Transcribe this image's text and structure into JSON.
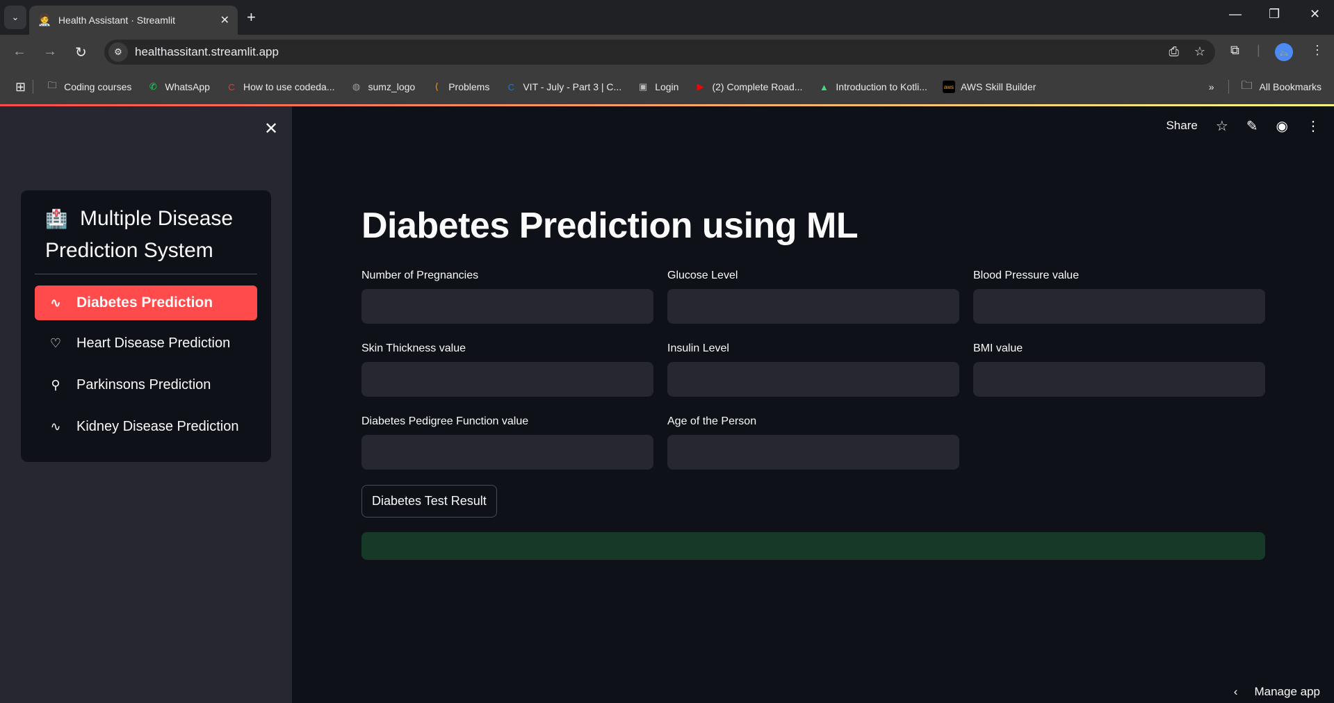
{
  "browser": {
    "tab_title": "Health Assistant · Streamlit",
    "tab_favicon": "🧑‍⚕️",
    "url": "healthassitant.streamlit.app",
    "bookmarks": [
      {
        "label": "Coding courses",
        "icon": "folder-icon",
        "glyph": "🗀",
        "color": "#e8eaed"
      },
      {
        "label": "WhatsApp",
        "icon": "whatsapp-icon",
        "glyph": "✆",
        "color": "#25d366"
      },
      {
        "label": "How to use codeda...",
        "icon": "c-logo-icon",
        "glyph": "C",
        "color": "#e53935"
      },
      {
        "label": "sumz_logo",
        "icon": "globe-icon",
        "glyph": "◍",
        "color": "#9aa0a6"
      },
      {
        "label": "Problems",
        "icon": "leetcode-icon",
        "glyph": "⟨",
        "color": "#ffa116"
      },
      {
        "label": "VIT - July - Part 3 | C...",
        "icon": "c-circle-icon",
        "glyph": "C",
        "color": "#1a73e8"
      },
      {
        "label": "Login",
        "icon": "login-icon",
        "glyph": "▣",
        "color": "#bdbdbd"
      },
      {
        "label": "(2) Complete Road...",
        "icon": "youtube-icon",
        "glyph": "▶",
        "color": "#ff0000"
      },
      {
        "label": "Introduction to Kotli...",
        "icon": "android-icon",
        "glyph": "▲",
        "color": "#3ddc84"
      },
      {
        "label": "AWS Skill Builder",
        "icon": "aws-icon",
        "glyph": "aws",
        "color": "#ff9900"
      }
    ],
    "all_bookmarks_label": "All Bookmarks",
    "accent_gradient": [
      "#ff4b4b",
      "#fffd80"
    ]
  },
  "sidebar": {
    "title": "Multiple Disease Prediction System",
    "title_icon": "🏥",
    "items": [
      {
        "label": "Diabetes Prediction",
        "icon": "activity-icon",
        "glyph": "∿",
        "active": true
      },
      {
        "label": "Heart Disease Prediction",
        "icon": "heart-icon",
        "glyph": "♡",
        "active": false
      },
      {
        "label": "Parkinsons Prediction",
        "icon": "person-icon",
        "glyph": "⚲",
        "active": false
      },
      {
        "label": "Kidney Disease Prediction",
        "icon": "activity-icon",
        "glyph": "∿",
        "active": false
      }
    ],
    "active_color": "#ff4b4b"
  },
  "topbar": {
    "share_label": "Share"
  },
  "main": {
    "title": "Diabetes Prediction using ML",
    "fields": [
      {
        "label": "Number of Pregnancies",
        "value": "",
        "placeholder": ""
      },
      {
        "label": "Glucose Level",
        "value": "",
        "placeholder": ""
      },
      {
        "label": "Blood Pressure value",
        "value": "",
        "placeholder": ""
      },
      {
        "label": "Skin Thickness value",
        "value": "",
        "placeholder": ""
      },
      {
        "label": "Insulin Level",
        "value": "",
        "placeholder": ""
      },
      {
        "label": "BMI value",
        "value": "",
        "placeholder": ""
      },
      {
        "label": "Diabetes Pedigree Function value",
        "value": "",
        "placeholder": ""
      },
      {
        "label": "Age of the Person",
        "value": "",
        "placeholder": ""
      }
    ],
    "submit_label": "Diabetes Test Result",
    "result_text": "",
    "result_color": "#173928"
  },
  "footer": {
    "manage_label": "Manage app"
  }
}
